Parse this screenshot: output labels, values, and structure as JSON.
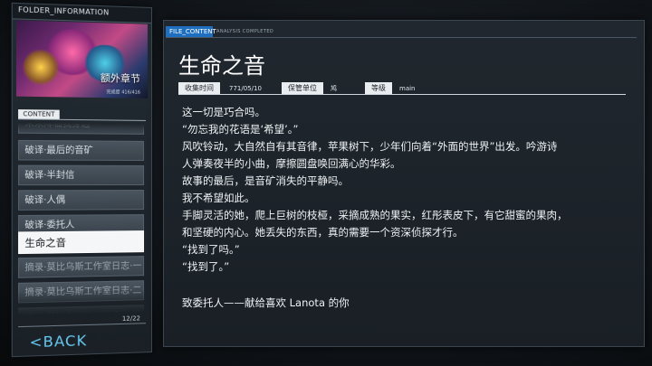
{
  "left_panel": {
    "header": "FOLDER_INFORMATION",
    "banner_title": "额外章节",
    "banner_subtitle": "完成度 416/416",
    "content_tag": "CONTENT",
    "items": [
      {
        "label": "未来降临我身边"
      },
      {
        "label": "破译·最后的音矿"
      },
      {
        "label": "破译·半封信"
      },
      {
        "label": "破译·人偶"
      },
      {
        "label": "破译·委托人"
      },
      {
        "label": "生命之音",
        "selected": true
      },
      {
        "label": "摘录·莫比乌斯工作室日志·一"
      },
      {
        "label": "摘录·莫比乌斯工作室日志·二"
      },
      {
        "label": "摘录·莫比乌斯工作室日志·三"
      }
    ],
    "page_count": "12/22",
    "back_label": "<BACK"
  },
  "file": {
    "tab_label": "FILE_CONTENT",
    "tab_sub": "ANALYSIS COMPLETED",
    "title": "生命之音",
    "meta": {
      "collect_time_label": "收集时间",
      "collect_time_value": "771/05/10",
      "keeper_label": "保管单位",
      "keeper_value": "鸠",
      "level_label": "等级",
      "level_value": "main"
    },
    "body_lines": [
      "这一切是巧合吗。",
      "“勿忘我的花语是‘希望’。”",
      "风吹铃动，大自然自有其音律，苹果树下，少年们向着“外面的世界”出发。吟游诗",
      "人弹奏夜半的小曲，摩擦圆盘唤回满心的华彩。",
      "故事的最后，是音矿消失的平静吗。",
      "我不希望如此。",
      "手脚灵活的她，爬上巨树的枝桠，采摘成熟的果实，红彤表皮下，有它甜蜜的果肉，",
      "和坚硬的内心。她丢失的东西，真的需要一个资深侦探才行。",
      "“找到了吗。”",
      "“找到了。”"
    ],
    "dedication": "致委托人——献给喜欢 Lanota 的你"
  }
}
